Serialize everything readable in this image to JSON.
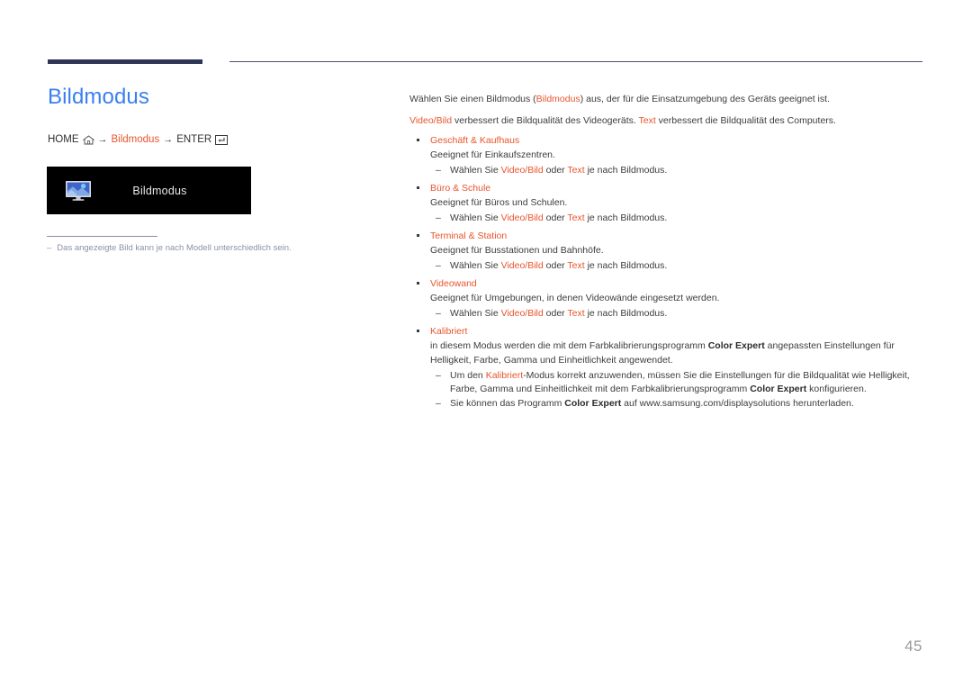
{
  "document": {
    "page_number": "45",
    "accent_color": "#e8552d",
    "title_color": "#3a7fef",
    "rule_color": "#2e3557",
    "note_color": "#8b90ab"
  },
  "left": {
    "title": "Bildmodus",
    "breadcrumb": {
      "home_label": "HOME",
      "home_icon": "home-icon",
      "arrow1": "→",
      "menu_label": "Bildmodus",
      "arrow2": "→",
      "enter_label": "ENTER",
      "enter_icon": "enter-key-icon"
    },
    "preview": {
      "icon": "monitor-picture-icon",
      "label": "Bildmodus"
    },
    "note": {
      "dash": "–",
      "text": "Das angezeigte Bild kann je nach Modell unterschiedlich sein."
    }
  },
  "right": {
    "intro": {
      "line1_a": "Wählen Sie einen Bildmodus (",
      "line1_accent": "Bildmodus",
      "line1_b": ") aus, der für die Einsatzumgebung des Geräts geeignet ist.",
      "line2_accent1": "Video/Bild",
      "line2_a": " verbessert die Bildqualität des Videogeräts. ",
      "line2_accent2": "Text",
      "line2_b": " verbessert die Bildqualität des Computers."
    },
    "modes": [
      {
        "name": "Geschäft & Kaufhaus",
        "description": "Geeignet für Einkaufszentren.",
        "sub": {
          "a": "Wählen Sie ",
          "accent1": "Video/Bild",
          "b": " oder ",
          "accent2": "Text",
          "c": " je nach Bildmodus."
        }
      },
      {
        "name": "Büro & Schule",
        "description": "Geeignet für Büros und Schulen.",
        "sub": {
          "a": "Wählen Sie ",
          "accent1": "Video/Bild",
          "b": " oder ",
          "accent2": "Text",
          "c": " je nach Bildmodus."
        }
      },
      {
        "name": "Terminal & Station",
        "description": "Geeignet für Busstationen und Bahnhöfe.",
        "sub": {
          "a": "Wählen Sie ",
          "accent1": "Video/Bild",
          "b": " oder ",
          "accent2": "Text",
          "c": " je nach Bildmodus."
        }
      },
      {
        "name": "Videowand",
        "description": "Geeignet für Umgebungen, in denen Videowände eingesetzt werden.",
        "sub": {
          "a": "Wählen Sie ",
          "accent1": "Video/Bild",
          "b": " oder ",
          "accent2": "Text",
          "c": " je nach Bildmodus."
        }
      }
    ],
    "calibrated": {
      "name": "Kalibriert",
      "desc_a": "in diesem Modus werden die mit dem Farbkalibrierungsprogramm ",
      "desc_bold": "Color Expert",
      "desc_b": " angepassten Einstellungen für Helligkeit, Farbe, Gamma und Einheitlichkeit angewendet.",
      "sub1_a": "Um den ",
      "sub1_accent": "Kalibriert",
      "sub1_b": "-Modus korrekt anzuwenden, müssen Sie die Einstellungen für die Bildqualität wie Helligkeit, Farbe, Gamma und Einheitlichkeit mit dem Farbkalibrierungsprogramm ",
      "sub1_bold": "Color Expert",
      "sub1_c": " konfigurieren.",
      "sub2_a": "Sie können das Programm ",
      "sub2_bold": "Color Expert",
      "sub2_b": " auf www.samsung.com/displaysolutions herunterladen."
    }
  }
}
